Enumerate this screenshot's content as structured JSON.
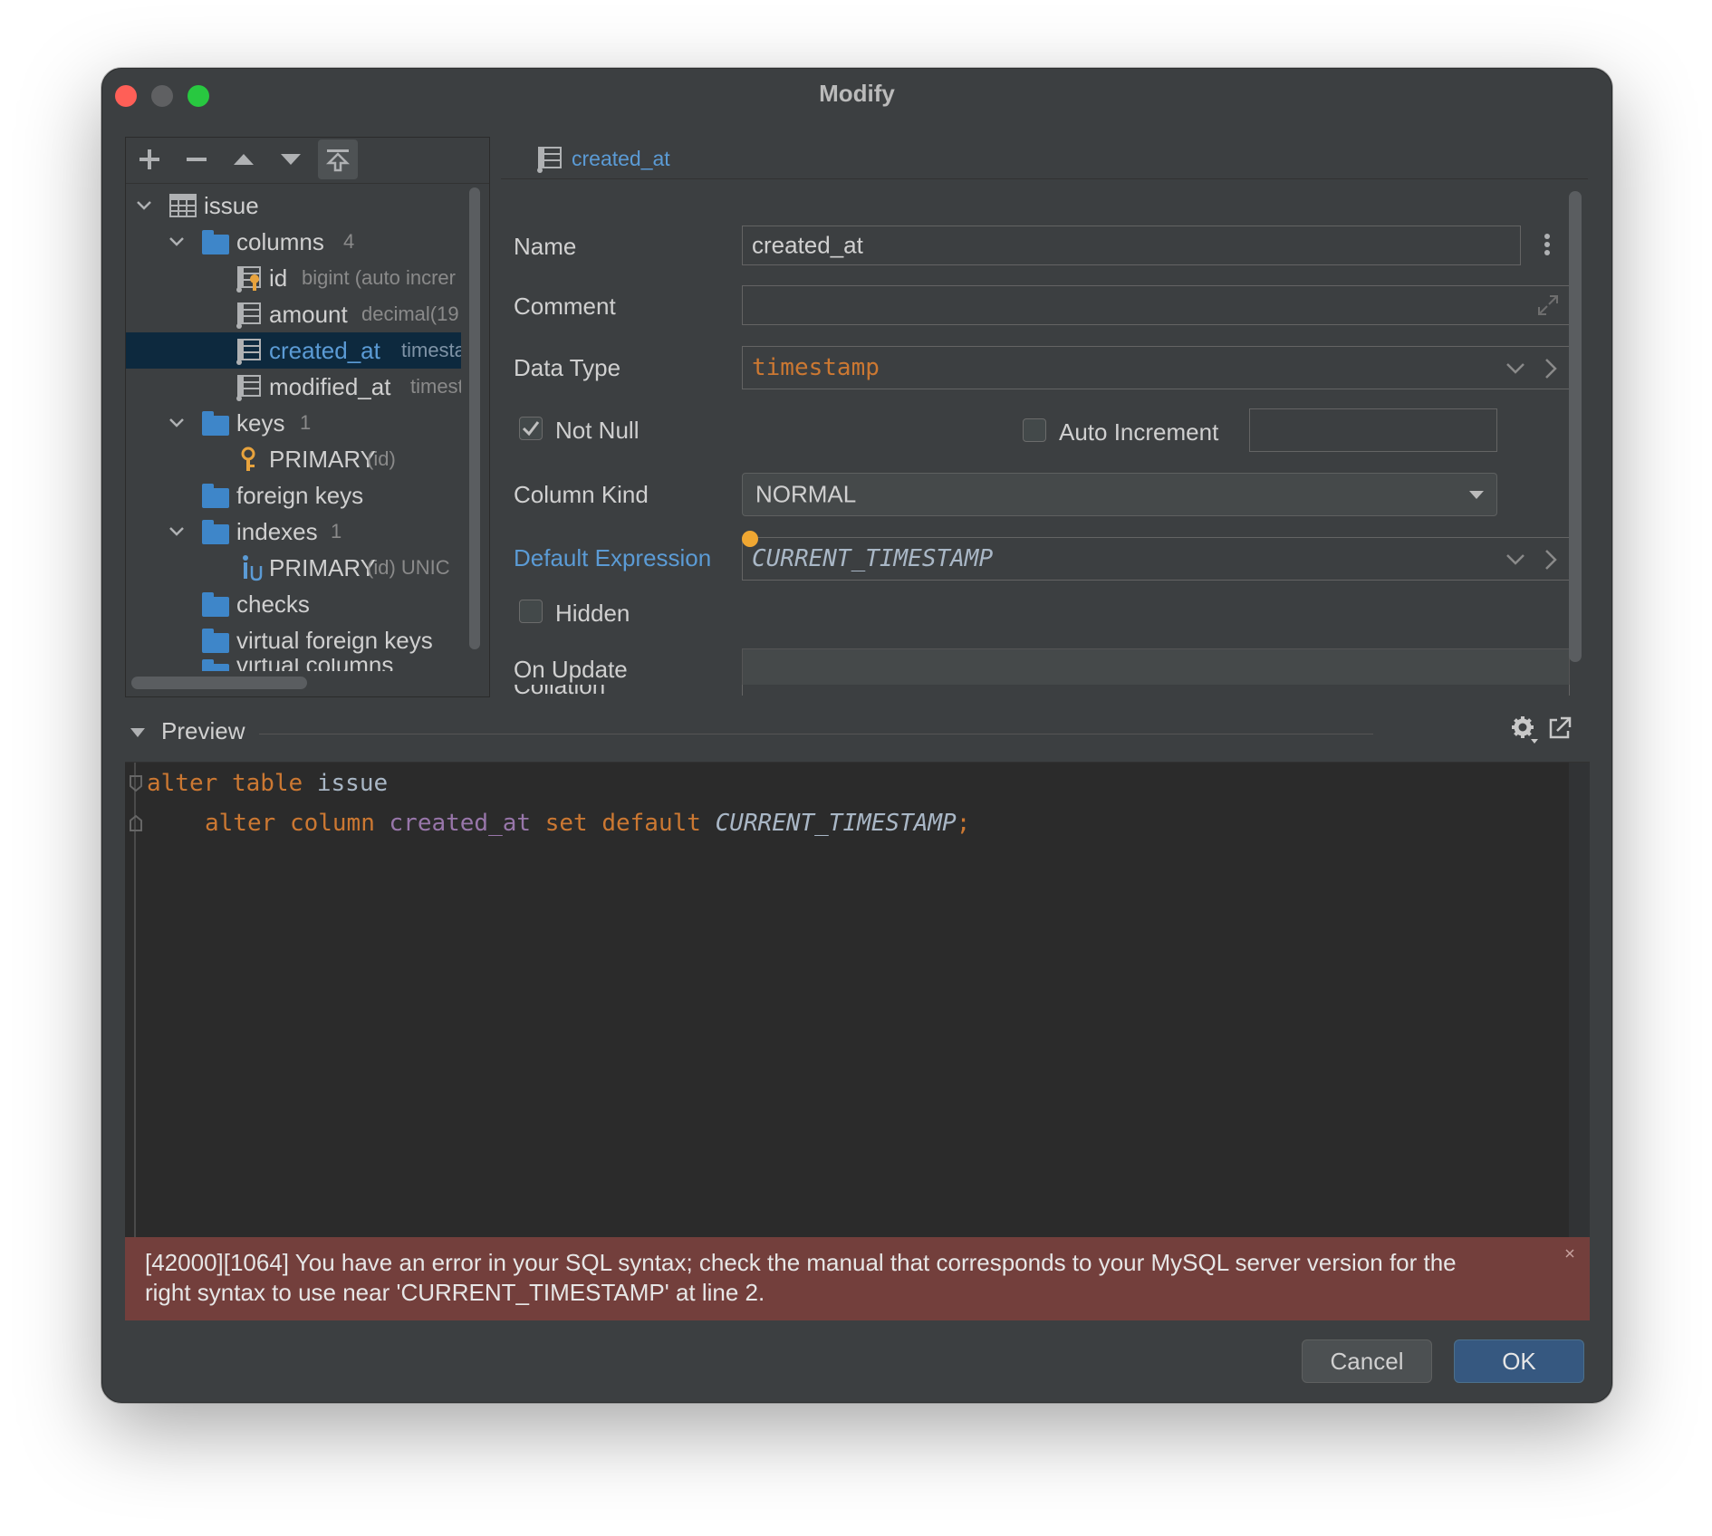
{
  "window": {
    "title": "Modify"
  },
  "tree": {
    "root": {
      "label": "issue"
    },
    "columns": {
      "label": "columns",
      "count": "4"
    },
    "column_items": [
      {
        "name": "id",
        "type": "bigint (auto increr"
      },
      {
        "name": "amount",
        "type": "decimal(19"
      },
      {
        "name": "created_at",
        "type": "timesta"
      },
      {
        "name": "modified_at",
        "type": "timest"
      }
    ],
    "keys": {
      "label": "keys",
      "count": "1"
    },
    "key_items": [
      {
        "name": "PRIMARY",
        "detail": "(id)"
      }
    ],
    "foreign_keys": {
      "label": "foreign keys"
    },
    "indexes": {
      "label": "indexes",
      "count": "1"
    },
    "index_items": [
      {
        "name": "PRIMARY",
        "detail": "(id) UNIC"
      }
    ],
    "checks": {
      "label": "checks"
    },
    "virtual_foreign_keys": {
      "label": "virtual foreign keys"
    },
    "virtual_columns": {
      "label": "virtual columns"
    }
  },
  "form": {
    "header_title": "created_at",
    "name_label": "Name",
    "name_value": "created_at",
    "comment_label": "Comment",
    "comment_value": "",
    "data_type_label": "Data Type",
    "data_type_value": "timestamp",
    "not_null_label": "Not Null",
    "not_null_checked": true,
    "auto_increment_label": "Auto Increment",
    "auto_increment_checked": false,
    "auto_increment_value": "",
    "column_kind_label": "Column Kind",
    "column_kind_value": "NORMAL",
    "default_expression_label": "Default Expression",
    "default_expression_value": "CURRENT_TIMESTAMP",
    "hidden_label": "Hidden",
    "hidden_checked": false,
    "on_update_label": "On Update",
    "on_update_value": "",
    "collation_label": "Collation"
  },
  "preview": {
    "label": "Preview",
    "line1": {
      "kw1": "alter",
      "kw2": "table",
      "table": "issue"
    },
    "line2": {
      "kw1": "alter",
      "kw2": "column",
      "column": "created_at",
      "kw3": "set",
      "kw4": "default",
      "value": "CURRENT_TIMESTAMP",
      "end": ";"
    }
  },
  "error": {
    "line1": "[42000][1064] You have an error in your SQL syntax; check the manual that corresponds to your MySQL server version for the",
    "line2": "right syntax to use near 'CURRENT_TIMESTAMP' at line 2."
  },
  "buttons": {
    "cancel": "Cancel",
    "ok": "OK"
  },
  "colors": {
    "accent": "#365880",
    "link": "#5b9bd5",
    "type_orange": "#cc7832",
    "error_bg": "#733f3c",
    "selection": "#0d293e",
    "folder": "#3e86c9"
  }
}
